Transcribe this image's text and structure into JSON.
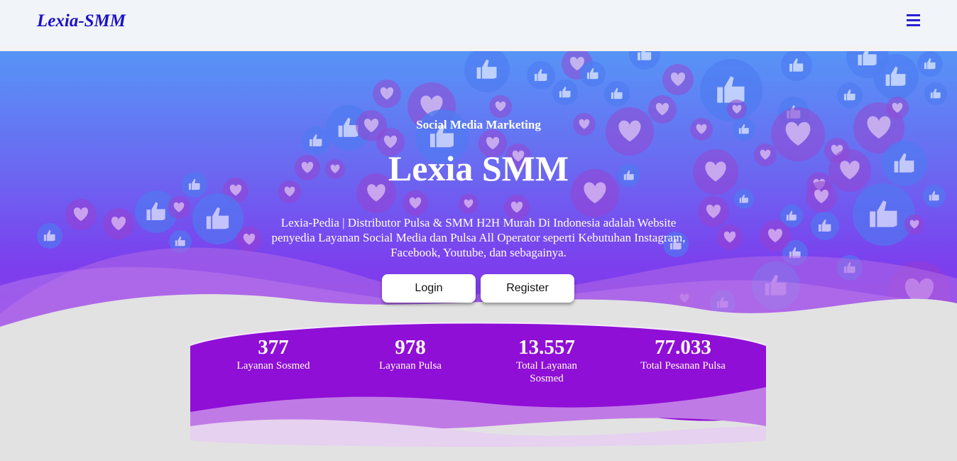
{
  "navbar": {
    "brand": "Lexia-SMM",
    "menu_icon": "hamburger-icon"
  },
  "hero": {
    "tagline": "Social Media Marketing",
    "title": "Lexia SMM",
    "description": "Lexia-Pedia | Distributor Pulsa & SMM H2H Murah Di Indonesia adalah Website penyedia Layanan Social Media dan Pulsa All Operator seperti Kebutuhan Instagram, Facebook, Youtube, dan sebagainya.",
    "buttons": {
      "login": "Login",
      "register": "Register"
    },
    "background_icons": [
      "thumbs-up-icon",
      "heart-icon"
    ]
  },
  "stats": [
    {
      "value": "377",
      "label": "Layanan Sosmed"
    },
    {
      "value": "978",
      "label": "Layanan Pulsa"
    },
    {
      "value": "13.557",
      "label": "Total Layanan Sosmed"
    },
    {
      "value": "77.033",
      "label": "Total Pesanan Pulsa"
    }
  ],
  "colors": {
    "brand": "#1b12c6",
    "stats_bg": "#8f0fd6",
    "hero_top": "#5794f7",
    "hero_mid": "#7c3fee"
  }
}
